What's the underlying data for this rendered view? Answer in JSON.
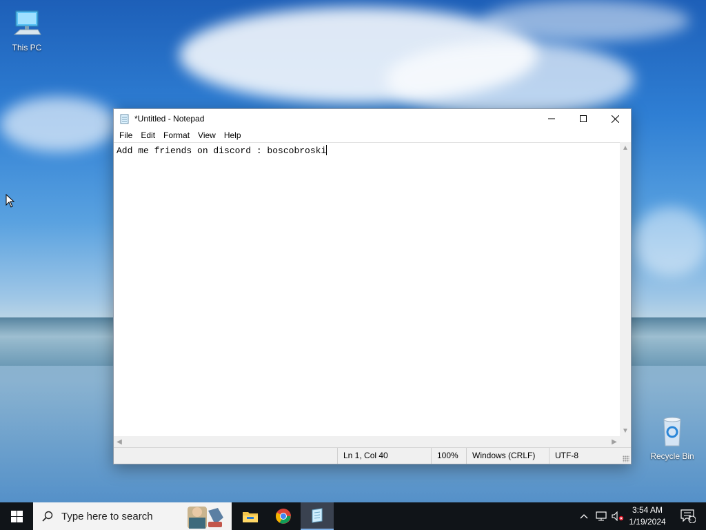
{
  "desktop": {
    "icons": [
      {
        "label": "This PC"
      },
      {
        "label": "Recycle Bin"
      }
    ]
  },
  "notepad": {
    "title": "*Untitled - Notepad",
    "menu": [
      "File",
      "Edit",
      "Format",
      "View",
      "Help"
    ],
    "content": "Add me friends on discord : boscobroski",
    "status": {
      "position": "Ln 1, Col 40",
      "zoom": "100%",
      "line_ending": "Windows (CRLF)",
      "encoding": "UTF-8"
    }
  },
  "taskbar": {
    "search_placeholder": "Type here to search",
    "apps": [
      "file-explorer-icon",
      "chrome-icon",
      "notepad-icon"
    ],
    "clock": {
      "time": "3:54 AM",
      "date": "1/19/2024"
    },
    "notification_count": "1"
  },
  "colors": {
    "taskbar": "#101418",
    "active_app_highlight": "#3a4250",
    "window_border": "#8e9aa8"
  }
}
